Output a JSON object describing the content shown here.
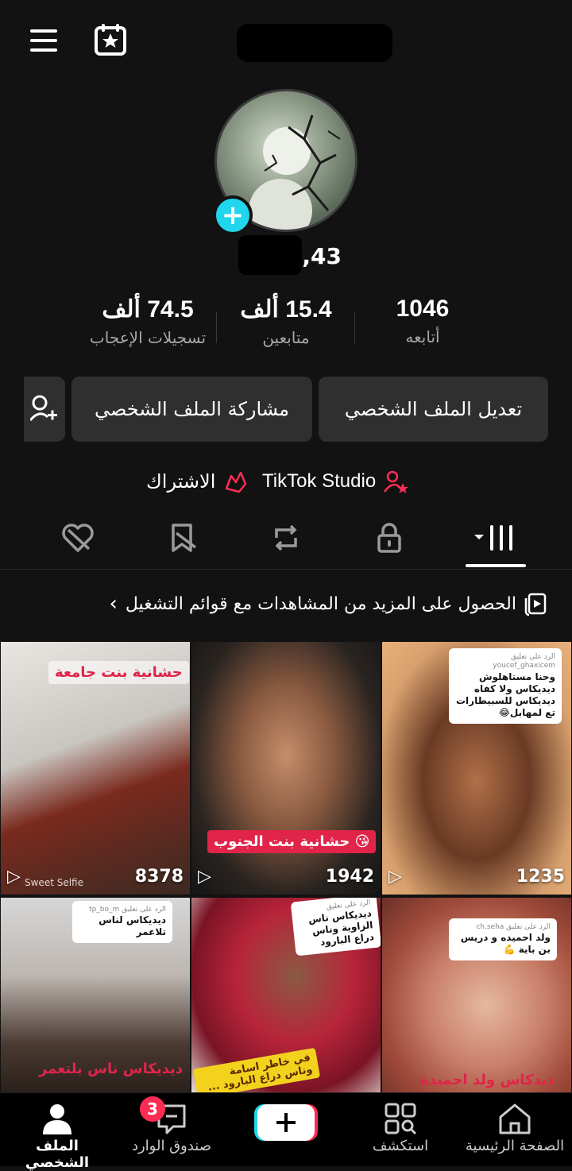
{
  "username_suffix": ",43",
  "stats": [
    {
      "value": "74.5 ألف",
      "label": "تسجيلات الإعجاب"
    },
    {
      "value": "15.4 ألف",
      "label": "متابعين"
    },
    {
      "value": "1046",
      "label": "أتابعه"
    }
  ],
  "buttons": {
    "edit_profile": "تعديل الملف الشخصي",
    "share_profile": "مشاركة الملف الشخصي"
  },
  "links": {
    "studio": "TikTok Studio",
    "subscription": "الاشتراك"
  },
  "promo": {
    "text": "الحصول على المزيد من المشاهدات مع قوائم التشغيل",
    "chevron": "‹"
  },
  "videos": [
    {
      "views": "8378",
      "caption": "حشانية بنت جامعة",
      "watermark": "Sweet Selfie"
    },
    {
      "views": "1942",
      "caption": "حشانية بنت الجنوب 😘"
    },
    {
      "views": "1235",
      "comment_user": "الرد على تعليق youcef_ghaxicem",
      "comment": "وحنا مستاهلوش ديديكاس ولا كفاه ديديكاس للسبيطارات تع لمهابل😂"
    },
    {
      "comment_user": "الرد على تعليق tp_bo_m",
      "comment": "ديديكاس لناس تلاعمر",
      "caption": "ديديكاس ناس بلتعمر"
    },
    {
      "comment_user": "الرد على تعليق",
      "comment": "ديديكاس ناس الزاوية وناس دراع البارود",
      "caption": "في خاطر اسامة وناس دراع البارود ..."
    },
    {
      "comment_user": "الرد على تعليق ch.seha",
      "comment": "ولد احميده و دريس بن باية 💪",
      "caption": "ديدكاس ولد احميدة"
    }
  ],
  "nav": {
    "home": "الصفحة الرئيسية",
    "discover": "استكشف",
    "inbox": "صندوق الوارد",
    "inbox_badge": "3",
    "profile": "الملف الشخصي"
  },
  "colors": {
    "background": "#121212",
    "accent_cyan": "#20d5ec",
    "accent_red": "#fe2c55",
    "button_bg": "#2f2f2f"
  }
}
